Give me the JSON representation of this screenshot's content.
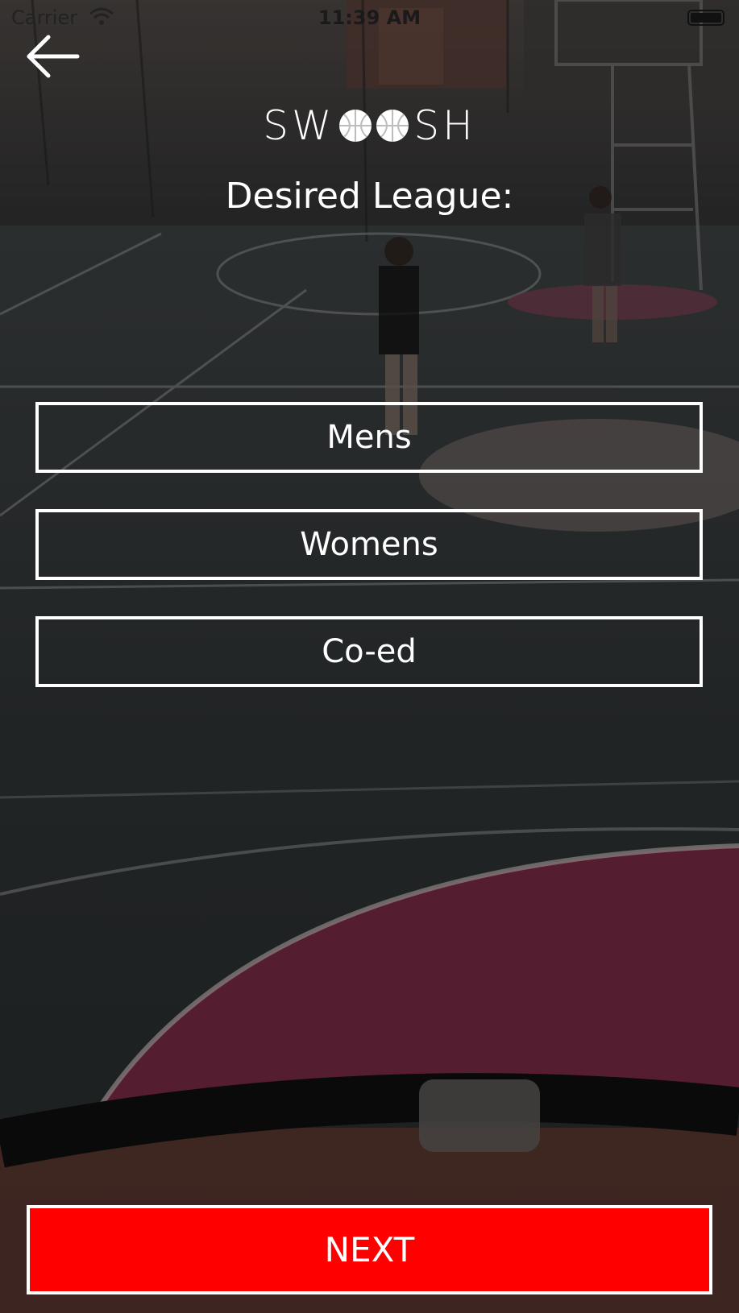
{
  "status_bar": {
    "carrier": "Carrier",
    "time": "11:39 AM"
  },
  "nav": {
    "back_icon": "arrow-left-icon"
  },
  "logo": {
    "prefix": "SW",
    "suffix": "SH",
    "ball_icon": "basketball-icon"
  },
  "page": {
    "title": "Desired League:"
  },
  "options": [
    {
      "label": "Mens"
    },
    {
      "label": "Womens"
    },
    {
      "label": "Co-ed"
    }
  ],
  "next_button": {
    "label": "NEXT"
  },
  "colors": {
    "accent": "#ff0000",
    "text": "#ffffff",
    "court_magenta": "#7e2744",
    "court_gray": "#34393a"
  }
}
